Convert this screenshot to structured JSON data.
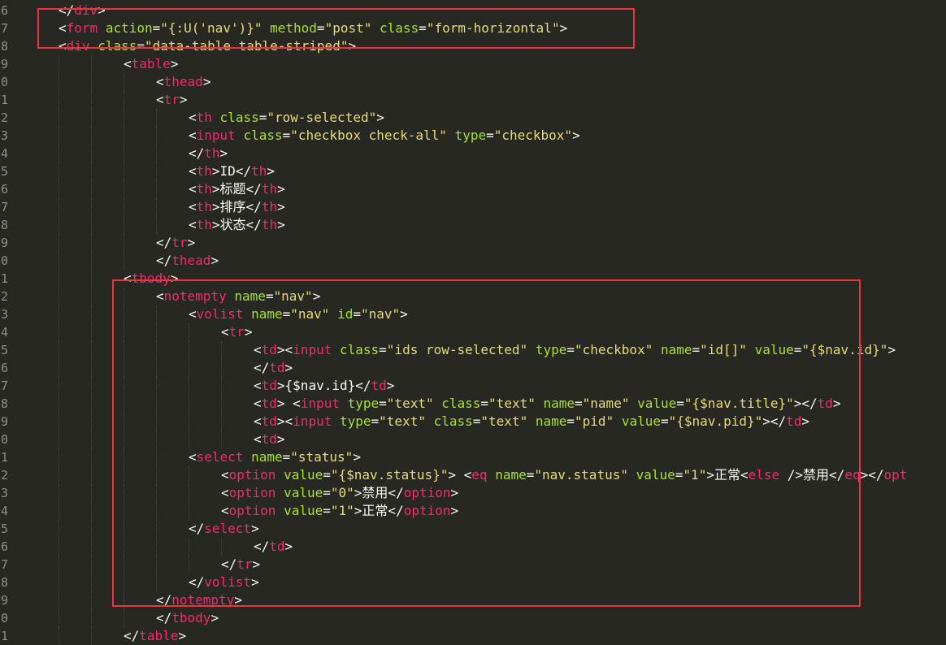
{
  "line_numbers": [
    "6",
    "7",
    "8",
    "9",
    "0",
    "1",
    "2",
    "3",
    "4",
    "5",
    "6",
    "7",
    "8",
    "9",
    "0",
    "1",
    "2",
    "3",
    "4",
    "5",
    "6",
    "7",
    "8",
    "9",
    "0",
    "1",
    "2",
    "3",
    "4",
    "5",
    "6",
    "7",
    "8",
    "9",
    "0",
    "1"
  ],
  "code_lines": [
    {
      "indent": 1,
      "tokens": [
        [
          "plain",
          "</"
        ],
        [
          "tag",
          "div"
        ],
        [
          "plain",
          ">"
        ]
      ]
    },
    {
      "indent": 1,
      "tokens": [
        [
          "plain",
          "<"
        ],
        [
          "tag",
          "form"
        ],
        [
          "plain",
          " "
        ],
        [
          "attr",
          "action"
        ],
        [
          "plain",
          "="
        ],
        [
          "str",
          "\"{:U('nav')}\""
        ],
        [
          "plain",
          " "
        ],
        [
          "attr",
          "method"
        ],
        [
          "plain",
          "="
        ],
        [
          "str",
          "\"post\""
        ],
        [
          "plain",
          " "
        ],
        [
          "attr",
          "class"
        ],
        [
          "plain",
          "="
        ],
        [
          "str",
          "\"form-horizontal\""
        ],
        [
          "plain",
          ">"
        ]
      ]
    },
    {
      "indent": 1,
      "tokens": [
        [
          "plain",
          "<"
        ],
        [
          "tag",
          "div"
        ],
        [
          "plain",
          " "
        ],
        [
          "attr",
          "class"
        ],
        [
          "plain",
          "="
        ],
        [
          "str",
          "\"data-table table-striped\""
        ],
        [
          "plain",
          ">"
        ]
      ]
    },
    {
      "indent": 3,
      "tokens": [
        [
          "plain",
          "<"
        ],
        [
          "tag",
          "table"
        ],
        [
          "plain",
          ">"
        ]
      ]
    },
    {
      "indent": 4,
      "tokens": [
        [
          "plain",
          "<"
        ],
        [
          "tag",
          "thead"
        ],
        [
          "plain",
          ">"
        ]
      ]
    },
    {
      "indent": 4,
      "tokens": [
        [
          "plain",
          "<"
        ],
        [
          "tag",
          "tr"
        ],
        [
          "plain",
          ">"
        ]
      ]
    },
    {
      "indent": 5,
      "tokens": [
        [
          "plain",
          "<"
        ],
        [
          "tag",
          "th"
        ],
        [
          "plain",
          " "
        ],
        [
          "attr",
          "class"
        ],
        [
          "plain",
          "="
        ],
        [
          "str",
          "\"row-selected\""
        ],
        [
          "plain",
          ">"
        ]
      ]
    },
    {
      "indent": 5,
      "tokens": [
        [
          "plain",
          "<"
        ],
        [
          "tag",
          "input"
        ],
        [
          "plain",
          " "
        ],
        [
          "attr",
          "class"
        ],
        [
          "plain",
          "="
        ],
        [
          "str",
          "\"checkbox check-all\""
        ],
        [
          "plain",
          " "
        ],
        [
          "attr",
          "type"
        ],
        [
          "plain",
          "="
        ],
        [
          "str",
          "\"checkbox\""
        ],
        [
          "plain",
          ">"
        ]
      ]
    },
    {
      "indent": 5,
      "tokens": [
        [
          "plain",
          "</"
        ],
        [
          "tag",
          "th"
        ],
        [
          "plain",
          ">"
        ]
      ]
    },
    {
      "indent": 5,
      "tokens": [
        [
          "plain",
          "<"
        ],
        [
          "tag",
          "th"
        ],
        [
          "plain",
          ">ID</"
        ],
        [
          "tag",
          "th"
        ],
        [
          "plain",
          ">"
        ]
      ]
    },
    {
      "indent": 5,
      "tokens": [
        [
          "plain",
          "<"
        ],
        [
          "tag",
          "th"
        ],
        [
          "plain",
          ">标题</"
        ],
        [
          "tag",
          "th"
        ],
        [
          "plain",
          ">"
        ]
      ]
    },
    {
      "indent": 5,
      "tokens": [
        [
          "plain",
          "<"
        ],
        [
          "tag",
          "th"
        ],
        [
          "plain",
          ">排序</"
        ],
        [
          "tag",
          "th"
        ],
        [
          "plain",
          ">"
        ]
      ]
    },
    {
      "indent": 5,
      "tokens": [
        [
          "plain",
          "<"
        ],
        [
          "tag",
          "th"
        ],
        [
          "plain",
          ">状态</"
        ],
        [
          "tag",
          "th"
        ],
        [
          "plain",
          ">"
        ]
      ]
    },
    {
      "indent": 4,
      "tokens": [
        [
          "plain",
          "</"
        ],
        [
          "tag",
          "tr"
        ],
        [
          "plain",
          ">"
        ]
      ]
    },
    {
      "indent": 4,
      "tokens": [
        [
          "plain",
          "</"
        ],
        [
          "tag",
          "thead"
        ],
        [
          "plain",
          ">"
        ]
      ]
    },
    {
      "indent": 3,
      "tokens": [
        [
          "plain",
          "<"
        ],
        [
          "tag",
          "tbody"
        ],
        [
          "plain",
          ">"
        ]
      ]
    },
    {
      "indent": 4,
      "tokens": [
        [
          "plain",
          "<"
        ],
        [
          "tag",
          "notempty"
        ],
        [
          "plain",
          " "
        ],
        [
          "attr",
          "name"
        ],
        [
          "plain",
          "="
        ],
        [
          "str",
          "\"nav\""
        ],
        [
          "plain",
          ">"
        ]
      ]
    },
    {
      "indent": 5,
      "tokens": [
        [
          "plain",
          "<"
        ],
        [
          "tag",
          "volist"
        ],
        [
          "plain",
          " "
        ],
        [
          "attr",
          "name"
        ],
        [
          "plain",
          "="
        ],
        [
          "str",
          "\"nav\""
        ],
        [
          "plain",
          " "
        ],
        [
          "attr",
          "id"
        ],
        [
          "plain",
          "="
        ],
        [
          "str",
          "\"nav\""
        ],
        [
          "plain",
          ">"
        ]
      ]
    },
    {
      "indent": 6,
      "tokens": [
        [
          "plain",
          "<"
        ],
        [
          "tag",
          "tr"
        ],
        [
          "plain",
          ">"
        ]
      ]
    },
    {
      "indent": 7,
      "tokens": [
        [
          "plain",
          "<"
        ],
        [
          "tag",
          "td"
        ],
        [
          "plain",
          "><"
        ],
        [
          "tag",
          "input"
        ],
        [
          "plain",
          " "
        ],
        [
          "attr",
          "class"
        ],
        [
          "plain",
          "="
        ],
        [
          "str",
          "\"ids row-selected\""
        ],
        [
          "plain",
          " "
        ],
        [
          "attr",
          "type"
        ],
        [
          "plain",
          "="
        ],
        [
          "str",
          "\"checkbox\""
        ],
        [
          "plain",
          " "
        ],
        [
          "attr",
          "name"
        ],
        [
          "plain",
          "="
        ],
        [
          "str",
          "\"id[]\""
        ],
        [
          "plain",
          " "
        ],
        [
          "attr",
          "value"
        ],
        [
          "plain",
          "="
        ],
        [
          "str",
          "\"{$nav.id}\""
        ],
        [
          "plain",
          ">"
        ]
      ]
    },
    {
      "indent": 7,
      "tokens": [
        [
          "plain",
          "</"
        ],
        [
          "tag",
          "td"
        ],
        [
          "plain",
          ">"
        ]
      ]
    },
    {
      "indent": 7,
      "tokens": [
        [
          "plain",
          "<"
        ],
        [
          "tag",
          "td"
        ],
        [
          "plain",
          ">{$nav.id}</"
        ],
        [
          "tag",
          "td"
        ],
        [
          "plain",
          ">"
        ]
      ]
    },
    {
      "indent": 7,
      "tokens": [
        [
          "plain",
          "<"
        ],
        [
          "tag",
          "td"
        ],
        [
          "plain",
          "> <"
        ],
        [
          "tag",
          "input"
        ],
        [
          "plain",
          " "
        ],
        [
          "attr",
          "type"
        ],
        [
          "plain",
          "="
        ],
        [
          "str",
          "\"text\""
        ],
        [
          "plain",
          " "
        ],
        [
          "attr",
          "class"
        ],
        [
          "plain",
          "="
        ],
        [
          "str",
          "\"text\""
        ],
        [
          "plain",
          " "
        ],
        [
          "attr",
          "name"
        ],
        [
          "plain",
          "="
        ],
        [
          "str",
          "\"name\""
        ],
        [
          "plain",
          " "
        ],
        [
          "attr",
          "value"
        ],
        [
          "plain",
          "="
        ],
        [
          "str",
          "\"{$nav.title}\""
        ],
        [
          "plain",
          "></"
        ],
        [
          "tag",
          "td"
        ],
        [
          "plain",
          ">"
        ]
      ]
    },
    {
      "indent": 7,
      "tokens": [
        [
          "plain",
          "<"
        ],
        [
          "tag",
          "td"
        ],
        [
          "plain",
          "><"
        ],
        [
          "tag",
          "input"
        ],
        [
          "plain",
          " "
        ],
        [
          "attr",
          "type"
        ],
        [
          "plain",
          "="
        ],
        [
          "str",
          "\"text\""
        ],
        [
          "plain",
          " "
        ],
        [
          "attr",
          "class"
        ],
        [
          "plain",
          "="
        ],
        [
          "str",
          "\"text\""
        ],
        [
          "plain",
          " "
        ],
        [
          "attr",
          "name"
        ],
        [
          "plain",
          "="
        ],
        [
          "str",
          "\"pid\""
        ],
        [
          "plain",
          " "
        ],
        [
          "attr",
          "value"
        ],
        [
          "plain",
          "="
        ],
        [
          "str",
          "\"{$nav.pid}\""
        ],
        [
          "plain",
          "></"
        ],
        [
          "tag",
          "td"
        ],
        [
          "plain",
          ">"
        ]
      ]
    },
    {
      "indent": 7,
      "tokens": [
        [
          "plain",
          "<"
        ],
        [
          "tag",
          "td"
        ],
        [
          "plain",
          ">"
        ]
      ]
    },
    {
      "indent": 5,
      "tokens": [
        [
          "plain",
          "<"
        ],
        [
          "tag",
          "select"
        ],
        [
          "plain",
          " "
        ],
        [
          "attr",
          "name"
        ],
        [
          "plain",
          "="
        ],
        [
          "str",
          "\"status\""
        ],
        [
          "plain",
          ">"
        ]
      ]
    },
    {
      "indent": 6,
      "tokens": [
        [
          "plain",
          "<"
        ],
        [
          "tag",
          "option"
        ],
        [
          "plain",
          " "
        ],
        [
          "attr",
          "value"
        ],
        [
          "plain",
          "="
        ],
        [
          "str",
          "\"{$nav.status}\""
        ],
        [
          "plain",
          "> <"
        ],
        [
          "tag",
          "eq"
        ],
        [
          "plain",
          " "
        ],
        [
          "attr",
          "name"
        ],
        [
          "plain",
          "="
        ],
        [
          "str",
          "\"nav.status\""
        ],
        [
          "plain",
          " "
        ],
        [
          "attr",
          "value"
        ],
        [
          "plain",
          "="
        ],
        [
          "str",
          "\"1\""
        ],
        [
          "plain",
          ">正常<"
        ],
        [
          "tag",
          "else"
        ],
        [
          "plain",
          " />禁用</"
        ],
        [
          "tag",
          "eq"
        ],
        [
          "plain",
          "></"
        ],
        [
          "tag",
          "opt"
        ]
      ]
    },
    {
      "indent": 6,
      "tokens": [
        [
          "plain",
          "<"
        ],
        [
          "tag",
          "option"
        ],
        [
          "plain",
          " "
        ],
        [
          "attr",
          "value"
        ],
        [
          "plain",
          "="
        ],
        [
          "str",
          "\"0\""
        ],
        [
          "plain",
          ">禁用</"
        ],
        [
          "tag",
          "option"
        ],
        [
          "plain",
          ">"
        ]
      ]
    },
    {
      "indent": 6,
      "tokens": [
        [
          "plain",
          "<"
        ],
        [
          "tag",
          "option"
        ],
        [
          "plain",
          " "
        ],
        [
          "attr",
          "value"
        ],
        [
          "plain",
          "="
        ],
        [
          "str",
          "\"1\""
        ],
        [
          "plain",
          ">正常</"
        ],
        [
          "tag",
          "option"
        ],
        [
          "plain",
          ">"
        ]
      ]
    },
    {
      "indent": 5,
      "tokens": [
        [
          "plain",
          "</"
        ],
        [
          "tag",
          "select"
        ],
        [
          "plain",
          ">"
        ]
      ]
    },
    {
      "indent": 7,
      "tokens": [
        [
          "plain",
          "</"
        ],
        [
          "tag",
          "td"
        ],
        [
          "plain",
          ">"
        ]
      ]
    },
    {
      "indent": 6,
      "tokens": [
        [
          "plain",
          "</"
        ],
        [
          "tag",
          "tr"
        ],
        [
          "plain",
          ">"
        ]
      ]
    },
    {
      "indent": 5,
      "tokens": [
        [
          "plain",
          "</"
        ],
        [
          "tag",
          "volist"
        ],
        [
          "plain",
          ">"
        ]
      ]
    },
    {
      "indent": 4,
      "tokens": [
        [
          "plain",
          "</"
        ],
        [
          "tag",
          "notempty"
        ],
        [
          "plain",
          ">"
        ]
      ]
    },
    {
      "indent": 4,
      "tokens": [
        [
          "plain",
          "</"
        ],
        [
          "tag",
          "tbody"
        ],
        [
          "plain",
          ">"
        ]
      ]
    },
    {
      "indent": 3,
      "tokens": [
        [
          "plain",
          "</"
        ],
        [
          "tag",
          "table"
        ],
        [
          "plain",
          ">"
        ]
      ]
    }
  ],
  "colors": {
    "background": "#272822",
    "tag": "#f92672",
    "attribute": "#a6e22e",
    "string": "#e6db74",
    "text": "#f8f8f2",
    "line_number": "#8f908a",
    "annotation_box": "#e8373c"
  }
}
